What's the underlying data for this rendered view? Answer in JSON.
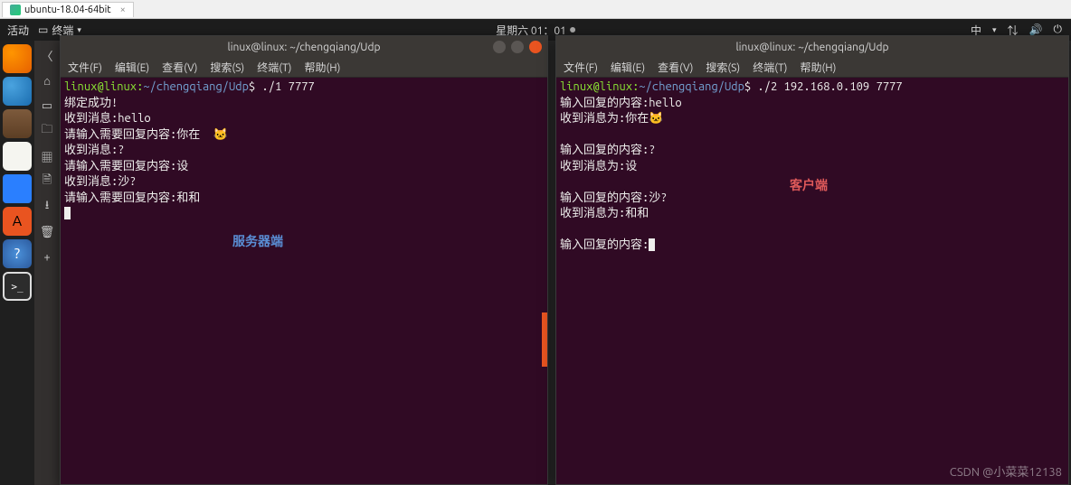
{
  "vm": {
    "tab_label": "ubuntu-18.04-64bit",
    "close_glyph": "×"
  },
  "topbar": {
    "activities": "活动",
    "app_indicator": "终端",
    "clock": "星期六 01：01",
    "lang_indicator": "中"
  },
  "terminal_menu": {
    "file": "文件(F)",
    "edit": "编辑(E)",
    "view": "查看(V)",
    "search": "搜索(S)",
    "terminal": "终端(T)",
    "help": "帮助(H)"
  },
  "server_window": {
    "title": "linux@linux: ~/chengqiang/Udp",
    "prompt_user": "linux@linux",
    "prompt_path": "~/chengqiang/Udp",
    "command": " ./1 7777",
    "lines": [
      "绑定成功!",
      "收到消息:hello",
      "请输入需要回复内容:你在  🐱",
      "收到消息:?",
      "请输入需要回复内容:设",
      "收到消息:沙?",
      "请输入需要回复内容:和和"
    ],
    "label": "服务器端"
  },
  "client_window": {
    "title": "linux@linux: ~/chengqiang/Udp",
    "prompt_user": "linux@linux",
    "prompt_path": "~/chengqiang/Udp",
    "command": " ./2 192.168.0.109 7777",
    "blocks": [
      "输入回复的内容:hello\n收到消息为:你在🐱",
      "输入回复的内容:?\n收到消息为:设",
      "输入回复的内容:沙?\n收到消息为:和和",
      "输入回复的内容:"
    ],
    "label": "客户端"
  },
  "watermark": "CSDN @小菜菜12138"
}
